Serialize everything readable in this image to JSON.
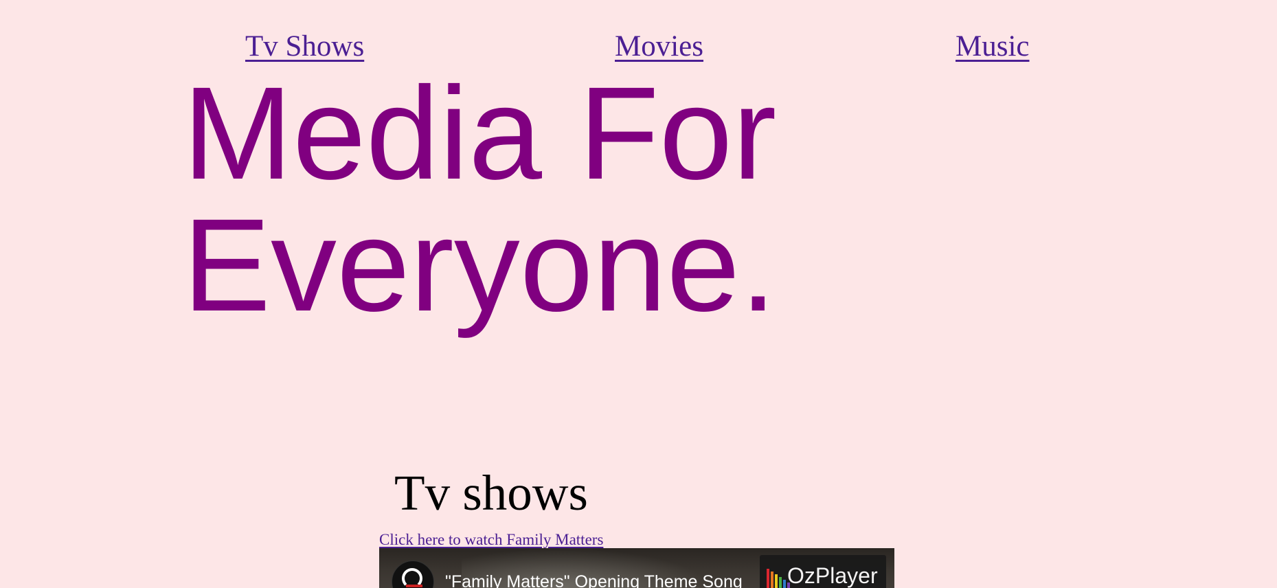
{
  "nav": {
    "items": [
      {
        "label": "Tv Shows"
      },
      {
        "label": "Movies"
      },
      {
        "label": "Music"
      }
    ]
  },
  "hero": {
    "line1": "Media For",
    "line2": "Everyone."
  },
  "tv_section": {
    "title": "Tv shows",
    "watch_link": "Click here to watch Family Matters",
    "video": {
      "title": "\"Family Matters\" Opening Theme Song",
      "player_name": "OzPlayer",
      "logo_colors": [
        "#e4262f",
        "#f07a21",
        "#f7d21d",
        "#4bb748",
        "#2f7fd3",
        "#7d3fb8"
      ]
    }
  },
  "colors": {
    "background": "#fde6e7",
    "link": "#4b1f93",
    "hero": "#800080"
  }
}
